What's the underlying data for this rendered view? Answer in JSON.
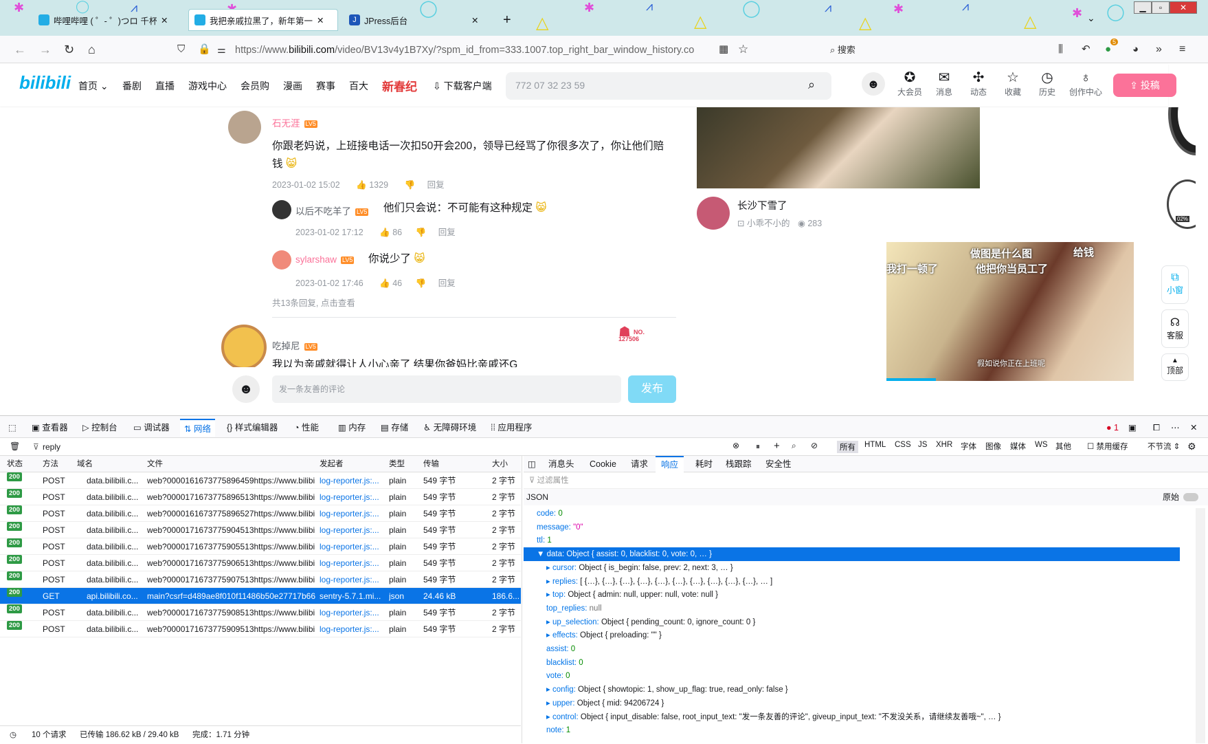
{
  "browser": {
    "tabs": [
      {
        "title": "哔哩哔哩 ( ゜- ゜)つロ 千杯~-bili"
      },
      {
        "title": "我把亲戚拉黑了，新年第一天我就"
      },
      {
        "title": "JPress后台"
      }
    ],
    "url_prefix": "https://www.",
    "url_domain": "bilibili.com",
    "url_path": "/video/BV13v4y1B7Xy/?spm_id_from=333.1007.top_right_bar_window_history.co",
    "search_label": "搜索",
    "badge_count": "5"
  },
  "bilibili_header": {
    "nav": [
      "首页",
      "番剧",
      "直播",
      "游戏中心",
      "会员购",
      "漫画",
      "赛事",
      "百大",
      "新春纪",
      "下载客户端"
    ],
    "search_value": "772 07 32 23 59",
    "icons": [
      "大会员",
      "消息",
      "动态",
      "收藏",
      "历史",
      "创作中心"
    ],
    "upload_label": "投稿"
  },
  "comments": {
    "main": {
      "user": "石无涯",
      "text": "你跟老妈说，上班接电话一次扣50开会200，领导已经骂了你很多次了，你让他们赔钱",
      "time": "2023-01-02 15:02",
      "likes": "1329",
      "reply": "回复"
    },
    "replies": [
      {
        "user": "以后不吃羊了",
        "text": "他们只会说：不可能有这种规定",
        "time": "2023-01-02 17:12",
        "likes": "86",
        "reply": "回复"
      },
      {
        "user": "sylarshaw",
        "text": "你说少了",
        "time": "2023-01-02 17:46",
        "likes": "46",
        "reply": "回复"
      }
    ],
    "more": "共13条回复, 点击查看",
    "next_user": "吃掉尼",
    "next_text": "我以为亲戚就得让人小心亲了 结果你爸妈比亲戚还G",
    "badge_no": "NO.",
    "badge_num": "127506",
    "input_placeholder": "发一条友善的评论",
    "send": "发布"
  },
  "sidebar_video": {
    "title": "长沙下雪了",
    "up": "小乖不小的",
    "views": "283",
    "overlay1": "做图是什么图",
    "overlay2": "给钱",
    "overlay3": "他把你当员工了",
    "overlay4": "我打一顿了",
    "subtitle": "假如说你正在上班呢"
  },
  "float_buttons": [
    "小窗",
    "客服",
    "顶部"
  ],
  "clock_pct": "02%",
  "devtools": {
    "tools": [
      "查看器",
      "控制台",
      "调试器",
      "网络",
      "样式编辑器",
      "性能",
      "内存",
      "存储",
      "无障碍环境",
      "应用程序"
    ],
    "error_count": "1",
    "filter_value": "reply",
    "type_filters": [
      "所有",
      "HTML",
      "CSS",
      "JS",
      "XHR",
      "字体",
      "图像",
      "媒体",
      "WS",
      "其他"
    ],
    "disable_cache": "禁用缓存",
    "throttle": "不节流",
    "columns": [
      "状态",
      "方法",
      "域名",
      "文件",
      "发起者",
      "类型",
      "传输",
      "大小"
    ],
    "rows": [
      {
        "status": "200",
        "method": "POST",
        "domain": "data.bilibili.c...",
        "file": "web?000016167377589645​9https://www.bilibil",
        "initiator": "log-reporter.js:...",
        "type": "plain",
        "transfer": "549 字节",
        "size": "2 字节"
      },
      {
        "status": "200",
        "method": "POST",
        "domain": "data.bilibili.c...",
        "file": "web?0000171673775896513https://www.bilibil",
        "initiator": "log-reporter.js:...",
        "type": "plain",
        "transfer": "549 字节",
        "size": "2 字节"
      },
      {
        "status": "200",
        "method": "POST",
        "domain": "data.bilibili.c...",
        "file": "web?0000161673775896527https://www.bilibil",
        "initiator": "log-reporter.js:...",
        "type": "plain",
        "transfer": "549 字节",
        "size": "2 字节"
      },
      {
        "status": "200",
        "method": "POST",
        "domain": "data.bilibili.c...",
        "file": "web?0000171673775904513https://www.bilibil",
        "initiator": "log-reporter.js:...",
        "type": "plain",
        "transfer": "549 字节",
        "size": "2 字节"
      },
      {
        "status": "200",
        "method": "POST",
        "domain": "data.bilibili.c...",
        "file": "web?0000171673775905513https://www.bilibil",
        "initiator": "log-reporter.js:...",
        "type": "plain",
        "transfer": "549 字节",
        "size": "2 字节"
      },
      {
        "status": "200",
        "method": "POST",
        "domain": "data.bilibili.c...",
        "file": "web?0000171673775906513https://www.bilibil",
        "initiator": "log-reporter.js:...",
        "type": "plain",
        "transfer": "549 字节",
        "size": "2 字节"
      },
      {
        "status": "200",
        "method": "POST",
        "domain": "data.bilibili.c...",
        "file": "web?0000171673775907513https://www.bilibil",
        "initiator": "log-reporter.js:...",
        "type": "plain",
        "transfer": "549 字节",
        "size": "2 字节"
      },
      {
        "status": "200",
        "method": "GET",
        "domain": "api.bilibili.co...",
        "file": "main?csrf=d489ae8f010f11486b50e27717b661",
        "initiator": "sentry-5.7.1.mi...",
        "type": "json",
        "transfer": "24.46 kB",
        "size": "186.6..."
      },
      {
        "status": "200",
        "method": "POST",
        "domain": "data.bilibili.c...",
        "file": "web?0000171673775908513https://www.bilibil",
        "initiator": "log-reporter.js:...",
        "type": "plain",
        "transfer": "549 字节",
        "size": "2 字节"
      },
      {
        "status": "200",
        "method": "POST",
        "domain": "data.bilibili.c...",
        "file": "web?0000171673775909513https://www.bilibil",
        "initiator": "log-reporter.js:...",
        "type": "plain",
        "transfer": "549 字节",
        "size": "2 字节"
      }
    ],
    "detail_tabs": [
      "消息头",
      "Cookie",
      "请求",
      "响应",
      "耗时",
      "栈跟踪",
      "安全性"
    ],
    "filter_props": "过滤属性",
    "json_label": "JSON",
    "raw_label": "原始",
    "json_lines": [
      {
        "t": "code: ",
        "v": "0",
        "c": "num"
      },
      {
        "t": "message: ",
        "v": "\"0\"",
        "c": "str"
      },
      {
        "t": "ttl: ",
        "v": "1",
        "c": "num"
      },
      {
        "t": "▼ data: ",
        "v": "Object { assist: 0, blacklist: 0, vote: 0, … }",
        "c": "plain"
      },
      {
        "t": "▸ cursor: ",
        "v": "Object { is_begin: false, prev: 2, next: 3, … }",
        "c": "plain"
      },
      {
        "t": "▸ replies: ",
        "v": "[ {…}, {…}, {…}, {…}, {…}, {…}, {…}, {…}, {…}, {…}, … ]",
        "c": "plain"
      },
      {
        "t": "▸ top: ",
        "v": "Object { admin: null, upper: null, vote: null }",
        "c": "plain"
      },
      {
        "t": "top_replies: ",
        "v": "null",
        "c": "gray"
      },
      {
        "t": "▸ up_selection: ",
        "v": "Object { pending_count: 0, ignore_count: 0 }",
        "c": "plain"
      },
      {
        "t": "▸ effects: ",
        "v": "Object { preloading: \"\" }",
        "c": "plain"
      },
      {
        "t": "assist: ",
        "v": "0",
        "c": "num"
      },
      {
        "t": "blacklist: ",
        "v": "0",
        "c": "num"
      },
      {
        "t": "vote: ",
        "v": "0",
        "c": "num"
      },
      {
        "t": "▸ config: ",
        "v": "Object { showtopic: 1, show_up_flag: true, read_only: false }",
        "c": "plain"
      },
      {
        "t": "▸ upper: ",
        "v": "Object { mid: 94206724 }",
        "c": "plain"
      },
      {
        "t": "▸ control: ",
        "v": "Object { input_disable: false, root_input_text: \"发一条友善的评论\", giveup_input_text: \"不发没关系，请继续友善哦~\", … }",
        "c": "plain"
      },
      {
        "t": "note: ",
        "v": "1",
        "c": "num"
      }
    ],
    "footer_requests": "10 个请求",
    "footer_transferred": "已传输 186.62 kB / 29.40 kB",
    "footer_finish": "完成：1.71 分钟"
  }
}
